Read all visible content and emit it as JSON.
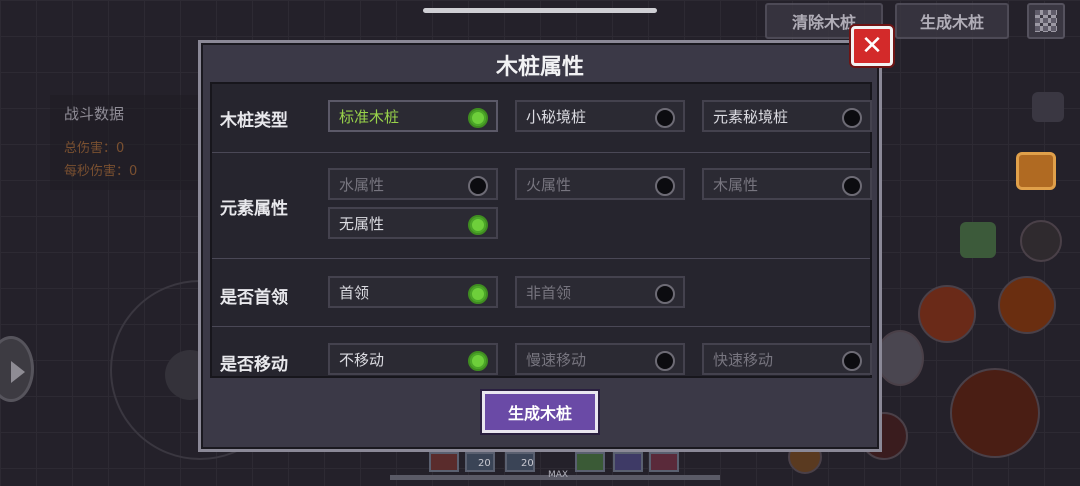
{
  "top_buttons": {
    "clear": "清除木桩",
    "generate": "生成木桩"
  },
  "battle_stats": {
    "title": "战斗数据",
    "total_damage": "总伤害：0",
    "dps": "每秒伤害：0"
  },
  "dialog": {
    "title": "木桩属性",
    "sections": [
      {
        "label": "木桩类型",
        "options": [
          {
            "text": "标准木桩",
            "selected": true
          },
          {
            "text": "小秘境桩",
            "selected": false
          },
          {
            "text": "元素秘境桩",
            "selected": false
          }
        ]
      },
      {
        "label": "元素属性",
        "options": [
          {
            "text": "水属性",
            "selected": false
          },
          {
            "text": "火属性",
            "selected": false
          },
          {
            "text": "木属性",
            "selected": false
          },
          {
            "text": "无属性",
            "selected": true
          }
        ]
      },
      {
        "label": "是否首领",
        "options": [
          {
            "text": "首领",
            "selected": true
          },
          {
            "text": "非首领",
            "selected": false
          }
        ]
      },
      {
        "label": "是否移动",
        "options": [
          {
            "text": "不移动",
            "selected": true
          },
          {
            "text": "慢速移动",
            "selected": false
          },
          {
            "text": "快速移动",
            "selected": false
          }
        ]
      }
    ],
    "generate_button": "生成木桩"
  },
  "hotbar": {
    "count_a": "20",
    "count_b": "20",
    "max_label": "MAX"
  },
  "colors": {
    "accent": "#6a4aa6",
    "selected": "#6ecf3b",
    "close": "#d32a2a",
    "highlight_text": "#98d24a"
  }
}
